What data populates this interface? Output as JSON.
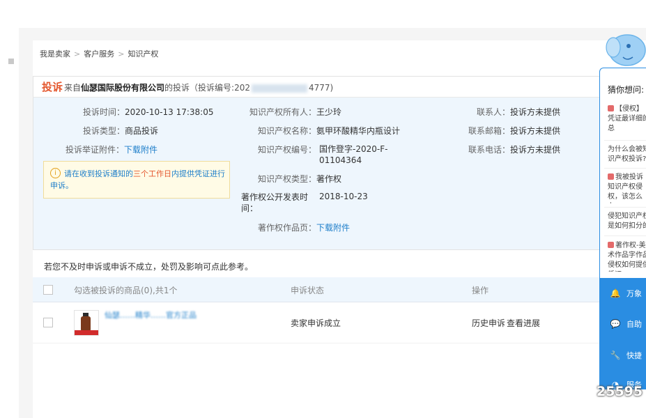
{
  "breadcrumb": [
    "我是卖家",
    "客户服务",
    "知识产权"
  ],
  "complaint": {
    "tag": "投诉",
    "from_prefix": "来自",
    "company": "仙瑟国际股份有限公司",
    "suffix_before_id": "的投诉（投诉编号:202",
    "id_tail": "4777)"
  },
  "details_left": [
    {
      "label": "投诉时间：",
      "value": "2020-10-13 17:38:05",
      "type": "text"
    },
    {
      "label": "投诉类型：",
      "value": "商品投诉",
      "type": "text"
    },
    {
      "label": "投诉举证附件：",
      "value": "下载附件",
      "type": "link"
    }
  ],
  "notice": {
    "prefix": "请在收到投诉通知的",
    "emphasis": "三个工作日",
    "suffix": "内提供凭证进行申诉。"
  },
  "details_mid": [
    {
      "label": "知识产权所有人：",
      "value": "王少玲"
    },
    {
      "label": "知识产权名称：",
      "value": "氨甲环酸精华内瓶设计"
    },
    {
      "label": "知识产权编号：",
      "value": "国作登字-2020-F-01104364"
    },
    {
      "label": "知识产权类型：",
      "value": "著作权"
    },
    {
      "label": "著作权公开发表时间：",
      "value": "2018-10-23"
    },
    {
      "label": "著作权作品页：",
      "value": "下载附件"
    }
  ],
  "details_right": [
    {
      "label": "联系人：",
      "value": "投诉方未提供"
    },
    {
      "label": "联系邮箱：",
      "value": "投诉方未提供"
    },
    {
      "label": "联系电话：",
      "value": "投诉方未提供"
    }
  ],
  "hint": "若您不及时申诉或申诉不成立，处罚及影响可点此参考。",
  "table": {
    "headers": [
      "勾选被投诉的商品(0),共1个",
      "申诉状态",
      "操作"
    ],
    "row": {
      "product_name": "仙瑟……精华……官方正品",
      "status": "卖家申诉成立",
      "actions": [
        "历史申诉",
        "查看进展"
      ]
    }
  },
  "assistant": {
    "title": "猜你想问:",
    "suggestions": [
      {
        "text": "【侵权】凭证最详细的总",
        "flag": true
      },
      {
        "text": "为什么会被知识产权投诉?",
        "flag": false
      },
      {
        "text": "我被投诉知识产权侵权，该怎么办?",
        "flag": true
      },
      {
        "text": "侵犯知识产权是如何扣分的",
        "flag": false
      },
      {
        "text": "著作权-美术作品字作品侵权如何提供凭证?",
        "flag": true
      }
    ],
    "menu": [
      {
        "icon": "bell-icon",
        "glyph": "🔔",
        "label": "万象"
      },
      {
        "icon": "chat-icon",
        "glyph": "💬",
        "label": "自助"
      },
      {
        "icon": "wrench-icon",
        "glyph": "🔧",
        "label": "快捷"
      },
      {
        "icon": "service-icon",
        "glyph": "◔",
        "label": "服务"
      }
    ]
  },
  "overlay_counter": "25595",
  "colors": {
    "accent": "#1f7fca",
    "warning": "#e4572e",
    "panel_blue": "#2a8de2",
    "info_bg": "#eef6fd"
  }
}
